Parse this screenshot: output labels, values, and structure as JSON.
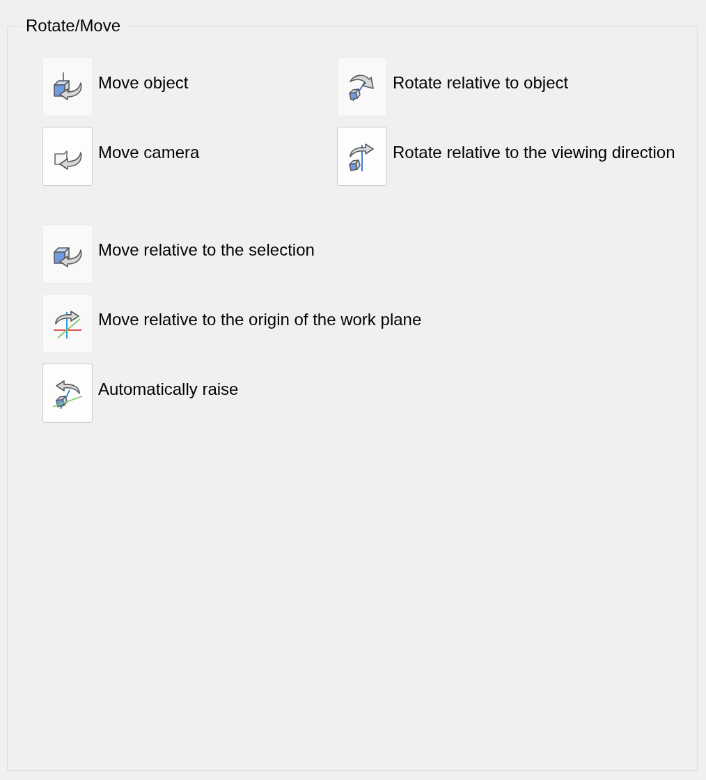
{
  "group": {
    "title": "Rotate/Move"
  },
  "sections": [
    {
      "kind": "grid",
      "items": [
        {
          "kind": "object",
          "label": "Move object",
          "checked": false
        },
        {
          "kind": "rotate",
          "label": "Rotate relative to object",
          "checked": false
        },
        {
          "kind": "camera",
          "label": "Move camera",
          "checked": true
        },
        {
          "kind": "view",
          "label": "Rotate relative to the viewing direction",
          "checked": true
        }
      ]
    },
    {
      "kind": "list",
      "items": [
        {
          "kind": "selection",
          "label": "Move relative to the selection",
          "checked": false
        },
        {
          "kind": "origin",
          "label": "Move relative to the origin of the work plane",
          "checked": false
        },
        {
          "kind": "raise",
          "label": "Automatically raise",
          "checked": true
        }
      ]
    }
  ]
}
